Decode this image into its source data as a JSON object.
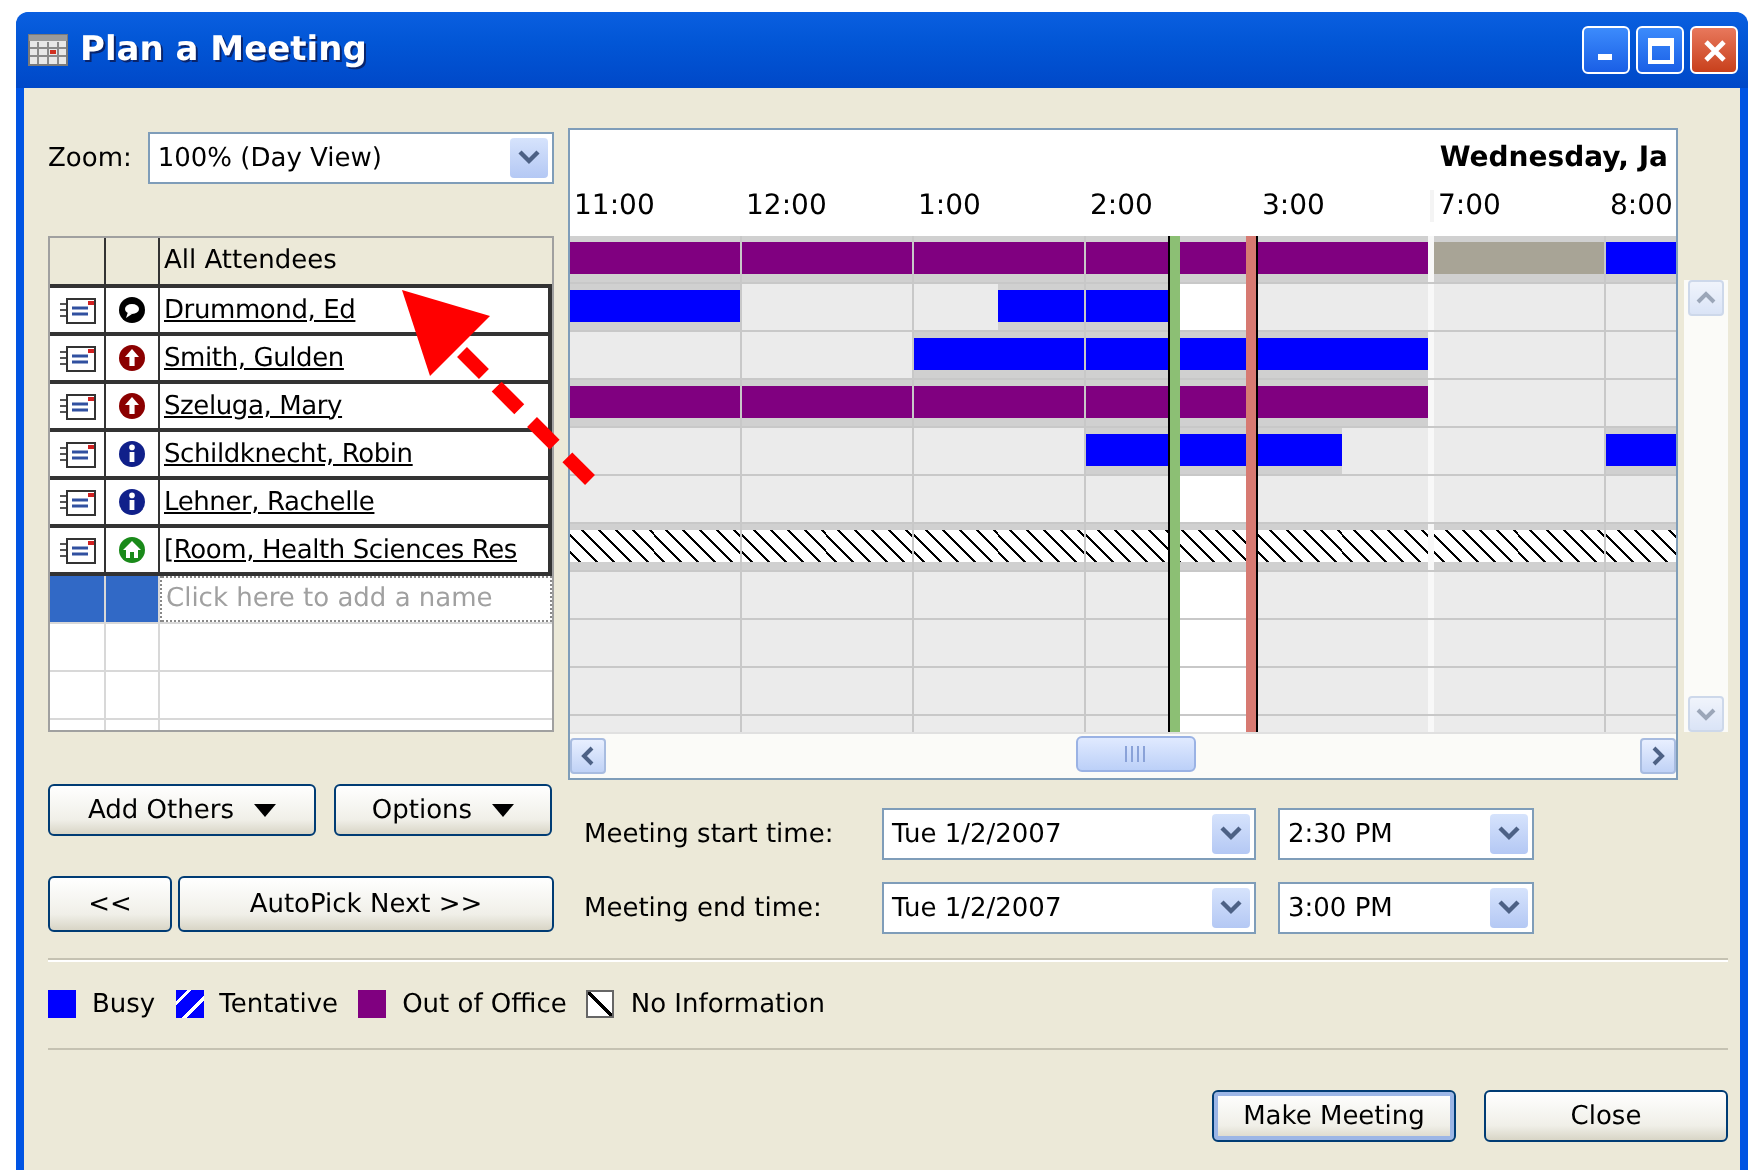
{
  "window": {
    "title": "Plan a Meeting"
  },
  "title_buttons": [
    {
      "kind": "minimize"
    },
    {
      "kind": "maximize"
    },
    {
      "kind": "close"
    }
  ],
  "zoom": {
    "label": "Zoom:",
    "value": "100% (Day View)"
  },
  "attendees": {
    "header": "All Attendees",
    "placeholder": "Click here to add a name",
    "rows": [
      {
        "name": "Drummond, Ed",
        "kind": "organizer"
      },
      {
        "name": "Smith, Gulden",
        "kind": "required"
      },
      {
        "name": "Szeluga, Mary",
        "kind": "required"
      },
      {
        "name": "Schildknecht, Robin",
        "kind": "optional"
      },
      {
        "name": "Lehner, Rachelle",
        "kind": "optional"
      },
      {
        "name": "[Room, Health Sciences Res",
        "kind": "resource"
      }
    ]
  },
  "grid": {
    "date_label": "Wednesday, Ja",
    "hours": [
      {
        "label": "11:00",
        "day_end": false
      },
      {
        "label": "12:00",
        "day_end": false
      },
      {
        "label": "1:00",
        "day_end": false
      },
      {
        "label": "2:00",
        "day_end": false
      },
      {
        "label": "3:00",
        "day_end": true
      },
      {
        "label": "7:00",
        "day_end": false
      },
      {
        "label": "8:00",
        "day_end": false
      }
    ],
    "slots": [
      {
        "selected": false
      },
      {
        "selected": false
      },
      {
        "selected": false
      },
      {
        "selected": false
      },
      {
        "selected": false
      },
      {
        "selected": false
      },
      {
        "selected": false
      },
      {
        "selected": true
      },
      {
        "selected": false
      },
      {
        "selected": false
      },
      {
        "selected": false
      },
      {
        "selected": false
      },
      {
        "selected": false
      }
    ],
    "summary": {
      "slots": [
        {
          "kind": "out"
        },
        {
          "kind": "out"
        },
        {
          "kind": "out"
        },
        {
          "kind": "out"
        },
        {
          "kind": "out"
        },
        {
          "kind": "out"
        },
        {
          "kind": "out"
        },
        {
          "kind": "out"
        },
        {
          "kind": "out"
        },
        {
          "kind": "out"
        },
        {
          "kind": "off"
        },
        {
          "kind": "off"
        },
        {
          "kind": "busy"
        }
      ]
    },
    "rows": [
      {
        "slots": [
          {
            "kind": "busy"
          },
          {
            "kind": "busy"
          },
          {
            "kind": "free"
          },
          {
            "kind": "free"
          },
          {
            "kind": "free"
          },
          {
            "kind": "busy"
          },
          {
            "kind": "busy"
          },
          {
            "kind": "free"
          },
          {
            "kind": "free"
          },
          {
            "kind": "free"
          },
          {
            "kind": "free"
          },
          {
            "kind": "free"
          },
          {
            "kind": "free"
          }
        ]
      },
      {
        "slots": [
          {
            "kind": "free"
          },
          {
            "kind": "free"
          },
          {
            "kind": "free"
          },
          {
            "kind": "free"
          },
          {
            "kind": "busy"
          },
          {
            "kind": "busy"
          },
          {
            "kind": "busy"
          },
          {
            "kind": "busy"
          },
          {
            "kind": "busy"
          },
          {
            "kind": "busy"
          },
          {
            "kind": "free"
          },
          {
            "kind": "free"
          },
          {
            "kind": "free"
          }
        ]
      },
      {
        "slots": [
          {
            "kind": "out"
          },
          {
            "kind": "out"
          },
          {
            "kind": "out"
          },
          {
            "kind": "out"
          },
          {
            "kind": "out"
          },
          {
            "kind": "out"
          },
          {
            "kind": "out"
          },
          {
            "kind": "out"
          },
          {
            "kind": "out"
          },
          {
            "kind": "out"
          },
          {
            "kind": "free"
          },
          {
            "kind": "free"
          },
          {
            "kind": "free"
          }
        ]
      },
      {
        "slots": [
          {
            "kind": "free"
          },
          {
            "kind": "free"
          },
          {
            "kind": "free"
          },
          {
            "kind": "free"
          },
          {
            "kind": "free"
          },
          {
            "kind": "free"
          },
          {
            "kind": "busy"
          },
          {
            "kind": "busy"
          },
          {
            "kind": "busy"
          },
          {
            "kind": "free"
          },
          {
            "kind": "free"
          },
          {
            "kind": "free"
          },
          {
            "kind": "busy"
          }
        ]
      },
      {
        "slots": [
          {
            "kind": "free"
          },
          {
            "kind": "free"
          },
          {
            "kind": "free"
          },
          {
            "kind": "free"
          },
          {
            "kind": "free"
          },
          {
            "kind": "free"
          },
          {
            "kind": "free"
          },
          {
            "kind": "free"
          },
          {
            "kind": "free"
          },
          {
            "kind": "free"
          },
          {
            "kind": "free"
          },
          {
            "kind": "free"
          },
          {
            "kind": "free"
          }
        ]
      },
      {
        "slots": [
          {
            "kind": "none"
          },
          {
            "kind": "none"
          },
          {
            "kind": "none"
          },
          {
            "kind": "none"
          },
          {
            "kind": "none"
          },
          {
            "kind": "none"
          },
          {
            "kind": "none"
          },
          {
            "kind": "none"
          },
          {
            "kind": "none"
          },
          {
            "kind": "none"
          },
          {
            "kind": "none"
          },
          {
            "kind": "none"
          },
          {
            "kind": "none"
          }
        ]
      }
    ]
  },
  "left_buttons": [
    [
      {
        "label": "Add Others",
        "dropdown": true
      },
      {
        "label": "Options",
        "dropdown": true
      }
    ],
    [
      {
        "label": "<<",
        "dropdown": false
      },
      {
        "label": "AutoPick Next >>",
        "dropdown": false
      }
    ]
  ],
  "meeting_times": [
    {
      "label": "Meeting start time:",
      "date": "Tue 1/2/2007",
      "time": "2:30 PM"
    },
    {
      "label": "Meeting end time:",
      "date": "Tue 1/2/2007",
      "time": "3:00 PM"
    }
  ],
  "legend": [
    {
      "kind": "busy",
      "label": "Busy"
    },
    {
      "kind": "tentative",
      "label": "Tentative"
    },
    {
      "kind": "out",
      "label": "Out of Office"
    },
    {
      "kind": "none",
      "label": "No Information"
    }
  ],
  "buttons": [
    {
      "label": "Make Meeting",
      "default": true
    },
    {
      "label": "Close",
      "default": false
    }
  ],
  "annotation": {
    "kind": "dashed-arrow"
  }
}
